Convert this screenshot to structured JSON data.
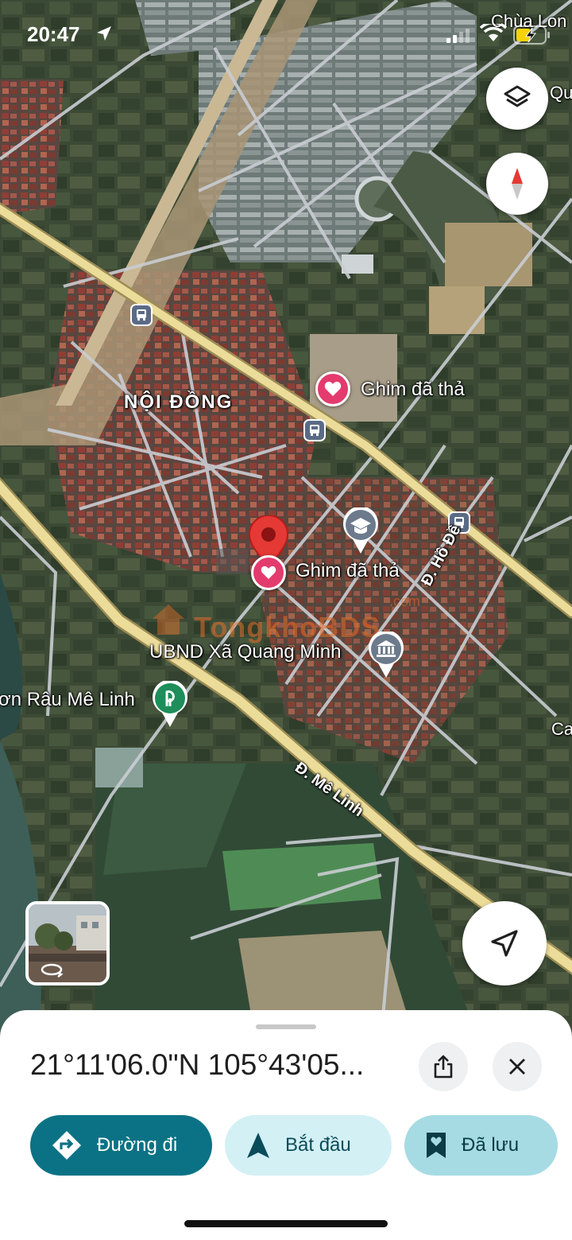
{
  "status_bar": {
    "time": "20:47",
    "icons": [
      "location-arrow-icon",
      "cellular-signal-icon",
      "wifi-icon",
      "battery-charging-icon"
    ]
  },
  "map": {
    "labels": {
      "top_right_1": "Chùa Lon",
      "top_right_2": "Qu",
      "right_edge": "Ca",
      "place": "NỘI ĐỒNG",
      "pin_top": "Ghim đã thả",
      "pin_selected": "Ghim đã thả",
      "school_icon": "school-icon",
      "road_ho_de": "Đ. Hồ Đề",
      "ubnd": "UBND Xã Quang Minh",
      "park": "ơn Râu Mê Linh",
      "road_me_linh": "Đ. Mê Linh",
      "watermark": "TongkhoBDS",
      "watermark_suffix": ".com"
    },
    "colors": {
      "highway": "#ecdc9a",
      "street": "#c9cdd3",
      "saved_pin": "#e33b6d",
      "dropped_pin": "#e53935",
      "poi_gray": "#6c7a8c",
      "park_green": "#1e8e5a"
    }
  },
  "controls": {
    "layers_icon": "layers-icon",
    "compass_icon": "compass-icon",
    "my_location_icon": "navigation-arrow-icon",
    "street_view_icon": "rotate-360-icon"
  },
  "sheet": {
    "coordinates": "21°11'06.0\"N 105°43'05...",
    "share_icon": "share-icon",
    "close_icon": "close-icon",
    "buttons": {
      "directions": "Đường đi",
      "start": "Bắt đầu",
      "saved": "Đã lưu"
    },
    "colors": {
      "directions_bg": "#0b7285",
      "start_bg": "#d3f0f5",
      "saved_bg": "#a6dbe4"
    }
  }
}
